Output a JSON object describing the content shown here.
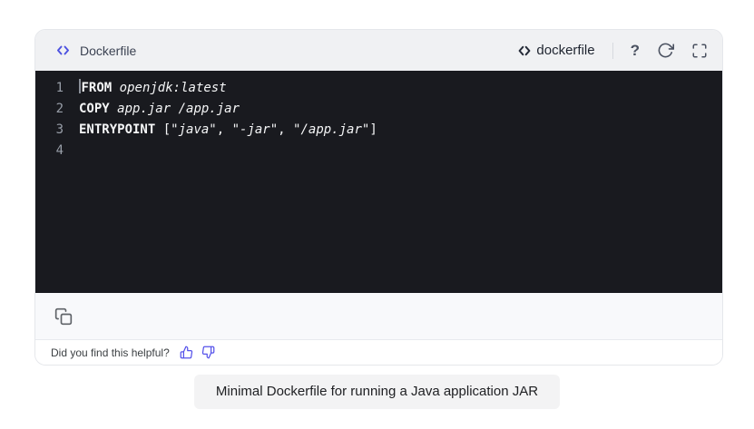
{
  "colors": {
    "accent_indigo": "#4c51e0",
    "thumb_indigo": "#5552ea",
    "icon_gray": "#4a5160",
    "header_background": "#f0f1f3",
    "code_background": "#191a1f",
    "code_text": "#f5f6f7",
    "line_number": "#989ea8",
    "caption_background": "#f3f3f4",
    "border_gray": "#e5e7eb"
  },
  "widget": {
    "header": {
      "title": "Dockerfile",
      "language": "dockerfile",
      "help_icon": "?"
    },
    "code": {
      "lines": [
        {
          "number": "1",
          "cursor": true,
          "segments": [
            {
              "style": "keyword",
              "text": "FROM"
            },
            {
              "style": "plain",
              "text": " "
            },
            {
              "style": "emph",
              "text": "openjdk:latest"
            }
          ]
        },
        {
          "number": "2",
          "segments": [
            {
              "style": "keyword",
              "text": "COPY"
            },
            {
              "style": "plain",
              "text": " "
            },
            {
              "style": "emph",
              "text": "app.jar /app.jar"
            }
          ]
        },
        {
          "number": "3",
          "segments": [
            {
              "style": "keyword",
              "text": "ENTRYPOINT"
            },
            {
              "style": "plain",
              "text": " ["
            },
            {
              "style": "emph",
              "text": "\"java\""
            },
            {
              "style": "plain",
              "text": ", "
            },
            {
              "style": "emph",
              "text": "\"-jar\""
            },
            {
              "style": "plain",
              "text": ", "
            },
            {
              "style": "emph",
              "text": "\"/app.jar\""
            },
            {
              "style": "plain",
              "text": "]"
            }
          ]
        },
        {
          "number": "4",
          "segments": []
        }
      ]
    },
    "footer": {
      "feedback_prompt": "Did you find this helpful?"
    }
  },
  "caption": "Minimal Dockerfile for running a Java application JAR"
}
